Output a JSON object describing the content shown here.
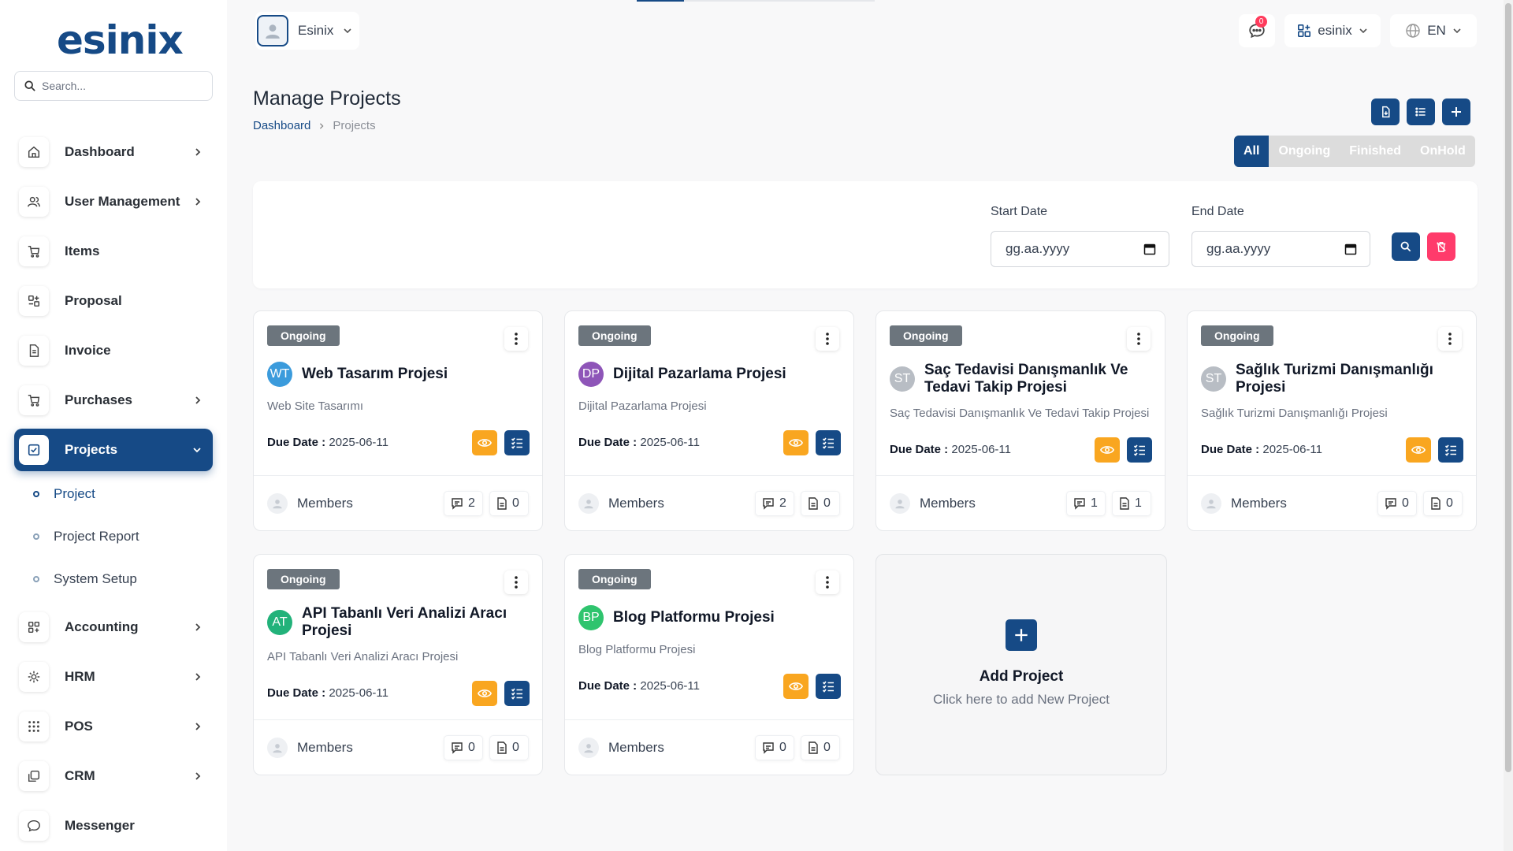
{
  "app": {
    "logo": "esinix"
  },
  "search": {
    "placeholder": "Search..."
  },
  "sidebar": {
    "items": [
      {
        "label": "Dashboard",
        "icon": "home-icon"
      },
      {
        "label": "User Management",
        "icon": "users-icon"
      },
      {
        "label": "Items",
        "icon": "cart-icon"
      },
      {
        "label": "Proposal",
        "icon": "proposal-icon"
      },
      {
        "label": "Invoice",
        "icon": "invoice-icon"
      },
      {
        "label": "Purchases",
        "icon": "cart-icon"
      },
      {
        "label": "Projects",
        "icon": "check-square-icon"
      },
      {
        "label": "Accounting",
        "icon": "grid-icon"
      },
      {
        "label": "HRM",
        "icon": "hrm-icon"
      },
      {
        "label": "POS",
        "icon": "dots-grid-icon"
      },
      {
        "label": "CRM",
        "icon": "crm-icon"
      },
      {
        "label": "Messenger",
        "icon": "chat-icon"
      }
    ],
    "sub_items": [
      "Project",
      "Project Report",
      "System Setup"
    ]
  },
  "topbar": {
    "org_name": "Esinix",
    "notification_count": "0",
    "workspace": "esinix",
    "language": "EN"
  },
  "page": {
    "title": "Manage Projects",
    "breadcrumb": [
      "Dashboard",
      "Projects"
    ]
  },
  "filter_tabs": [
    "All",
    "Ongoing",
    "Finished",
    "OnHold"
  ],
  "filter": {
    "start_label": "Start Date",
    "end_label": "End Date",
    "start_value": "gg.aa.yyyy",
    "end_value": "gg.aa.yyyy"
  },
  "projects": [
    {
      "status": "Ongoing",
      "initials": "WT",
      "avatar_color": "#3b9bdc",
      "title": "Web Tasarım Projesi",
      "description": "Web Site Tasarımı",
      "due_label": "Due Date :",
      "due": "2025-06-11",
      "members_label": "Members",
      "comments": "2",
      "files": "0"
    },
    {
      "status": "Ongoing",
      "initials": "DP",
      "avatar_color": "#8e55b8",
      "title": "Dijital Pazarlama Projesi",
      "description": "Dijital Pazarlama Projesi",
      "due_label": "Due Date :",
      "due": "2025-06-11",
      "members_label": "Members",
      "comments": "2",
      "files": "0"
    },
    {
      "status": "Ongoing",
      "initials": "ST",
      "avatar_color": "#b8bdc4",
      "title": "Saç Tedavisi Danışmanlık Ve Tedavi Takip Projesi",
      "description": "Saç Tedavisi Danışmanlık Ve Tedavi Takip Projesi",
      "due_label": "Due Date :",
      "due": "2025-06-11",
      "members_label": "Members",
      "comments": "1",
      "files": "1"
    },
    {
      "status": "Ongoing",
      "initials": "ST",
      "avatar_color": "#b8bdc4",
      "title": "Sağlık Turizmi Danışmanlığı Projesi",
      "description": "Sağlık Turizmi Danışmanlığı Projesi",
      "due_label": "Due Date :",
      "due": "2025-06-11",
      "members_label": "Members",
      "comments": "0",
      "files": "0"
    },
    {
      "status": "Ongoing",
      "initials": "AT",
      "avatar_color": "#22b27a",
      "title": "API Tabanlı Veri Analizi Aracı Projesi",
      "description": "API Tabanlı Veri Analizi Aracı Projesi",
      "due_label": "Due Date :",
      "due": "2025-06-11",
      "members_label": "Members",
      "comments": "0",
      "files": "0"
    },
    {
      "status": "Ongoing",
      "initials": "BP",
      "avatar_color": "#2fc46e",
      "title": "Blog Platformu Projesi",
      "description": "Blog Platformu Projesi",
      "due_label": "Due Date :",
      "due": "2025-06-11",
      "members_label": "Members",
      "comments": "0",
      "files": "0"
    }
  ],
  "add_project": {
    "title": "Add Project",
    "subtitle": "Click here to add New Project"
  },
  "colors": {
    "primary": "#164a86",
    "warning": "#f9a620",
    "danger": "#ff3b6b",
    "badge": "#6c757d"
  }
}
